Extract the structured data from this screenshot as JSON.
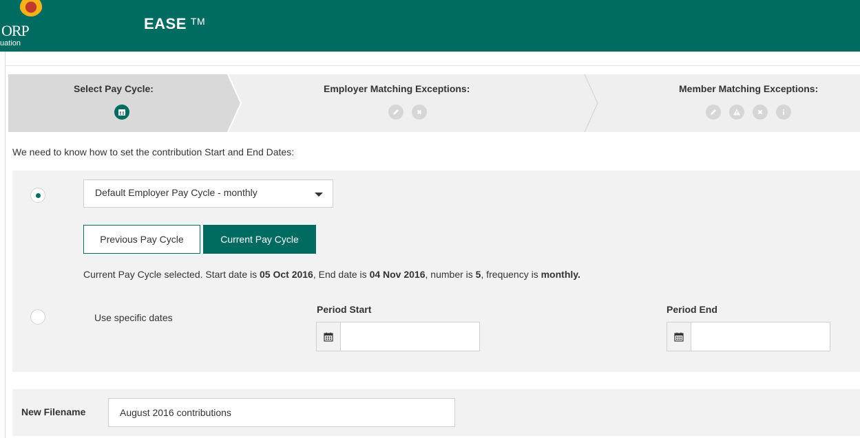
{
  "header": {
    "logo_text_top": "ORP",
    "logo_text_bottom": "uation",
    "app_title": "EASE",
    "trademark": "TM"
  },
  "wizard": {
    "steps": [
      {
        "label": "Select Pay Cycle:",
        "state": "active",
        "icons": [
          "calendar-icon"
        ]
      },
      {
        "label": "Employer Matching Exceptions:",
        "state": "inactive",
        "icons": [
          "pencil-icon",
          "x-icon"
        ]
      },
      {
        "label": "Member Matching Exceptions:",
        "state": "inactive",
        "icons": [
          "pencil-icon",
          "warning-icon",
          "x-icon",
          "info-icon"
        ]
      }
    ]
  },
  "intro_text": "We need to know how to set the contribution Start and End Dates:",
  "pay_cycle": {
    "selected_option": "Default Employer Pay Cycle - monthly",
    "option1_checked": true,
    "buttons": {
      "previous": "Previous Pay Cycle",
      "current": "Current Pay Cycle"
    },
    "status": {
      "prefix": "Current Pay Cycle selected. Start date is ",
      "start_date": "05 Oct 2016",
      "mid1": ", End date is ",
      "end_date": "04 Nov 2016",
      "mid2": ", number is ",
      "number": "5",
      "mid3": ", frequency is ",
      "frequency": "monthly."
    }
  },
  "specific_dates": {
    "label": "Use specific dates",
    "checked": false,
    "period_start_label": "Period Start",
    "period_start_value": "",
    "period_end_label": "Period End",
    "period_end_value": ""
  },
  "filename": {
    "label": "New Filename",
    "value": "August 2016 contributions"
  },
  "colors": {
    "brand": "#006b61",
    "panel": "#f2f2f2",
    "step_active": "#d9d9d9",
    "step_inactive": "#efefef"
  }
}
